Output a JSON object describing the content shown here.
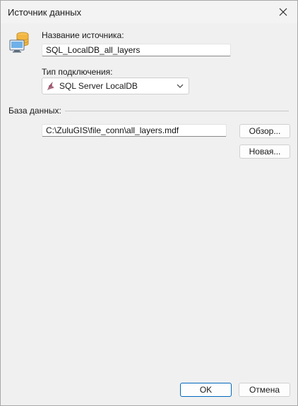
{
  "window": {
    "title": "Источник данных"
  },
  "icons": {
    "close": "close-icon",
    "datasource": "database-computer-icon",
    "connection_type": "sql-server-icon",
    "dropdown": "chevron-down-icon"
  },
  "source_name": {
    "label": "Название источника:",
    "value": "SQL_LocalDB_all_layers"
  },
  "connection_type": {
    "label": "Тип подключения:",
    "selected": "SQL Server LocalDB"
  },
  "database": {
    "group_label": "База данных:",
    "path": "C:\\ZuluGIS\\file_conn\\all_layers.mdf",
    "browse_label": "Обзор...",
    "new_label": "Новая..."
  },
  "footer": {
    "ok_label": "OK",
    "cancel_label": "Отмена"
  },
  "colors": {
    "accent": "#0067c0",
    "background": "#f0f0f0"
  }
}
